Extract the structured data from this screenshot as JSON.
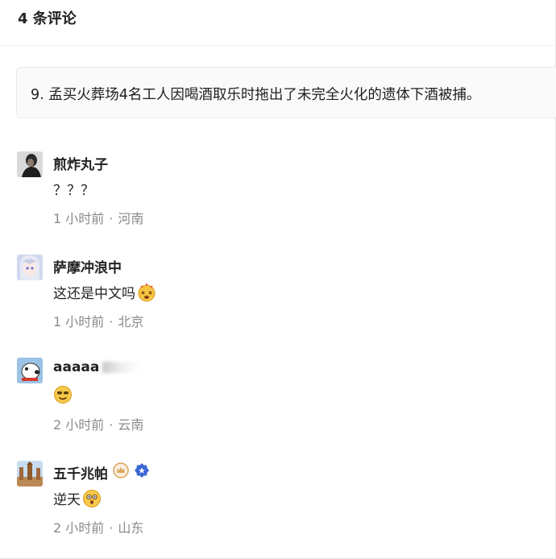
{
  "header": {
    "title": "4 条评论"
  },
  "quote": {
    "text": "9. 孟买火葬场4名工人因喝酒取乐时拖出了未完全火化的遗体下酒被捕。"
  },
  "comments": [
    {
      "username": "煎炸丸子",
      "content": "？？？",
      "time": "1 小时前",
      "location": "河南",
      "avatar_icon": "person-photo-avatar"
    },
    {
      "username": "萨摩冲浪中",
      "content": "这还是中文吗",
      "content_emoji": "dizzy-face-emoji",
      "time": "1 小时前",
      "location": "北京",
      "avatar_icon": "anime-girl-avatar"
    },
    {
      "username": "aaaaa",
      "content_emoji": "sunglasses-smile-emoji",
      "time": "2 小时前",
      "location": "云南",
      "avatar_icon": "cartoon-dog-avatar"
    },
    {
      "username": "五千兆帕",
      "content": "逆天",
      "content_emoji": "shocked-face-emoji",
      "time": "2 小时前",
      "location": "山东",
      "avatar_icon": "temple-photo-avatar",
      "badges": [
        "crown-badge-icon",
        "verified-badge-icon"
      ]
    }
  ],
  "meta_separator": "·",
  "colors": {
    "text": "#222222",
    "meta": "#8a8a8a",
    "border": "#ebebeb",
    "badge_gold": "#d9a45b",
    "badge_blue": "#3b66d6"
  }
}
